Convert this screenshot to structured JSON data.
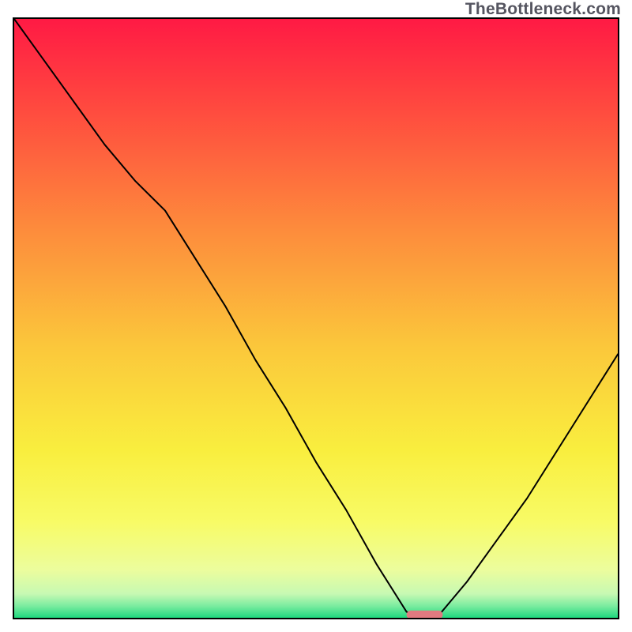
{
  "attribution": "TheBottleneck.com",
  "chart_data": {
    "type": "line",
    "title": "",
    "xlabel": "",
    "ylabel": "",
    "xlim": [
      0,
      100
    ],
    "ylim": [
      0,
      100
    ],
    "grid": false,
    "legend": false,
    "series": [
      {
        "name": "bottleneck-curve",
        "x": [
          0,
          5,
          10,
          15,
          20,
          25,
          30,
          35,
          40,
          45,
          50,
          55,
          60,
          65,
          67,
          70,
          75,
          80,
          85,
          90,
          95,
          100
        ],
        "y": [
          100,
          93,
          86,
          79,
          73,
          68,
          60,
          52,
          43,
          35,
          26,
          18,
          9,
          1,
          0,
          0,
          6,
          13,
          20,
          28,
          36,
          44
        ]
      }
    ],
    "marker": {
      "x": 68,
      "y": 0,
      "width": 6,
      "color": "#e07a80",
      "shape": "pill"
    },
    "gradient_stops": [
      {
        "pct": 0,
        "color": "#ff1a44"
      },
      {
        "pct": 15,
        "color": "#ff4a3f"
      },
      {
        "pct": 35,
        "color": "#fd8b3c"
      },
      {
        "pct": 55,
        "color": "#fbc83b"
      },
      {
        "pct": 72,
        "color": "#f9ee3e"
      },
      {
        "pct": 84,
        "color": "#f8fb66"
      },
      {
        "pct": 92,
        "color": "#ecfd9d"
      },
      {
        "pct": 96,
        "color": "#c7f9b3"
      },
      {
        "pct": 98,
        "color": "#7ceca0"
      },
      {
        "pct": 100,
        "color": "#1fd97f"
      }
    ]
  }
}
